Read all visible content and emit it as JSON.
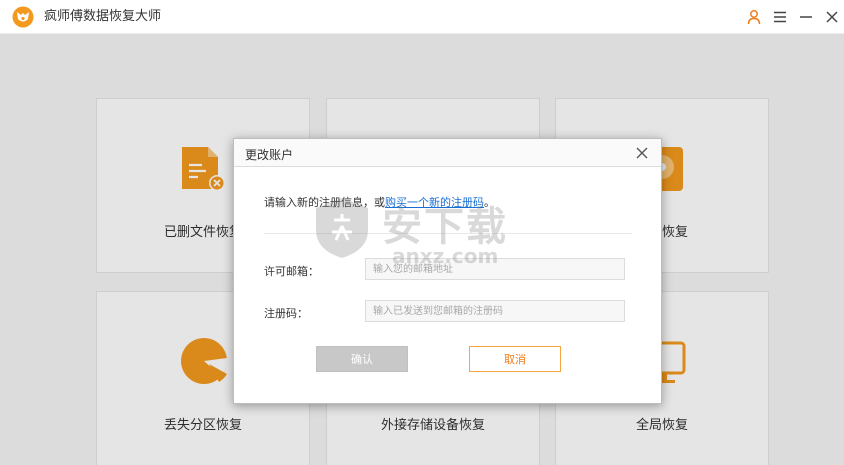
{
  "app": {
    "title": "疯师傅数据恢复大师",
    "logo_icon": "fox-logo-icon",
    "accent": "#f39a1e"
  },
  "titlebar": {
    "account_icon": "user-icon",
    "menu_icon": "menu-icon",
    "minimize_icon": "minimize-icon",
    "close_icon": "close-icon"
  },
  "cards": [
    {
      "label": "已删文件恢复",
      "icon": "deleted-file-icon"
    },
    {
      "label": "",
      "icon": ""
    },
    {
      "label": "磁盘恢复",
      "icon": "disk-icon"
    },
    {
      "label": "丢失分区恢复",
      "icon": "partition-icon"
    },
    {
      "label": "外接存储设备恢复",
      "icon": "external-storage-icon"
    },
    {
      "label": "全局恢复",
      "icon": "monitor-icon"
    }
  ],
  "dialog": {
    "title": "更改账户",
    "message_prefix": "请输入新的注册信息，或",
    "message_link": "购买一个新的注册码",
    "message_suffix": "。",
    "email_label": "许可邮箱：",
    "email_placeholder": "输入您的邮箱地址",
    "email_value": "",
    "code_label": "注册码：",
    "code_placeholder": "输入已发送到您邮箱的注册码",
    "code_value": "",
    "confirm_label": "确认",
    "cancel_label": "取消"
  },
  "watermark": {
    "text": "安下载",
    "sub": "anxz.com"
  }
}
